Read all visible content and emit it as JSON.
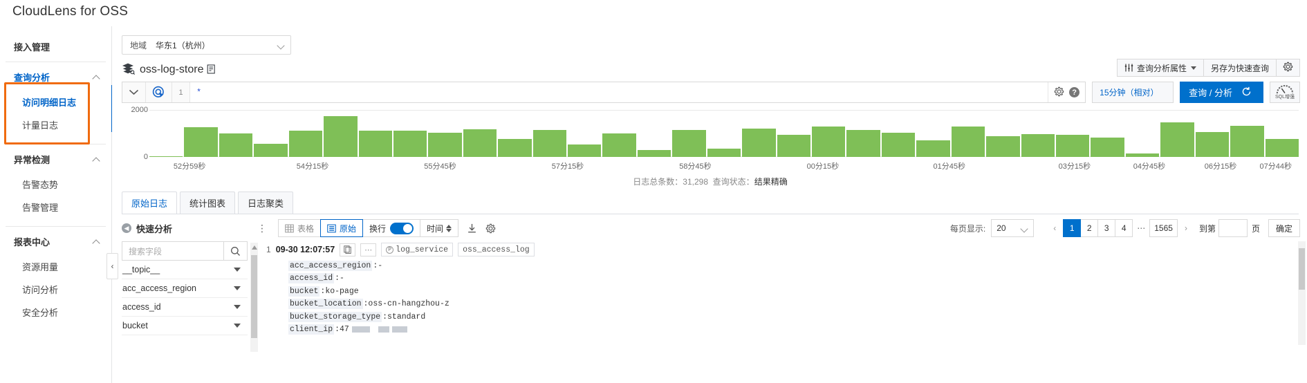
{
  "header": {
    "title": "CloudLens for OSS"
  },
  "sidebar": {
    "top_item": "接入管理",
    "groups": [
      {
        "title": "查询分析",
        "items": [
          "访问明细日志",
          "计量日志"
        ]
      },
      {
        "title": "异常检测",
        "items": [
          "告警态势",
          "告警管理"
        ]
      },
      {
        "title": "报表中心",
        "items": [
          "资源用量",
          "访问分析",
          "安全分析"
        ]
      }
    ],
    "collapse_glyph": "‹",
    "highlight_color": "#f06b0f",
    "active_color": "#0064c8"
  },
  "region": {
    "label": "地域",
    "value": "华东1（杭州）"
  },
  "logstore": {
    "name": "oss-log-store",
    "actions": [
      {
        "label": "查询分析属性",
        "has_caret": true,
        "icon": "sliders-icon"
      },
      {
        "label": "另存为快速查询",
        "has_caret": false,
        "icon": ""
      },
      {
        "label": "",
        "has_caret": false,
        "icon": "gear-icon"
      }
    ]
  },
  "query": {
    "line_number": "1",
    "value": "*",
    "time_range": "15分钟（相对）",
    "search_button": "查询 / 分析",
    "sql_label": "SQL增强"
  },
  "chart_data": {
    "type": "bar",
    "title": "",
    "xlabel": "",
    "ylabel": "",
    "ylim": [
      0,
      2000
    ],
    "ytick_labels": [
      "2000",
      "0"
    ],
    "grid": true,
    "legend": "none",
    "tick_labels": [
      "52分59秒",
      "54分15秒",
      "55分45秒",
      "57分15秒",
      "58分45秒",
      "00分15秒",
      "01分45秒",
      "03分15秒",
      "04分45秒",
      "06分15秒",
      "07分44秒"
    ],
    "tick_positions_pct": [
      3.5,
      14.2,
      25.3,
      36.4,
      47.5,
      58.6,
      69.6,
      80.5,
      87.0,
      93.2,
      98.0
    ],
    "categories": [
      "b1",
      "b2",
      "b3",
      "b4",
      "b5",
      "b6",
      "b7",
      "b8",
      "b9",
      "b10",
      "b11",
      "b12",
      "b13",
      "b14",
      "b15",
      "b16",
      "b17",
      "b18",
      "b19",
      "b20",
      "b21",
      "b22",
      "b23",
      "b24",
      "b25",
      "b26",
      "b27",
      "b28",
      "b29",
      "b30"
    ],
    "values": [
      40,
      1270,
      1000,
      560,
      1110,
      1740,
      1110,
      1110,
      1030,
      1180,
      760,
      1160,
      520,
      1000,
      300,
      1160,
      340,
      1200,
      950,
      1280,
      1150,
      1020,
      700,
      1290,
      870,
      980,
      940,
      810,
      160,
      1480
    ],
    "extra_values": [
      1060,
      1320,
      760
    ],
    "status_prefix": "日志总条数：",
    "status_count": "31,298",
    "status_label": "查询状态：",
    "status_value": "结果精确",
    "bar_color": "#7fbf57"
  },
  "tabs": [
    {
      "label": "原始日志",
      "active": true
    },
    {
      "label": "统计图表",
      "active": false
    },
    {
      "label": "日志聚类",
      "active": false
    }
  ],
  "content_toolbar": {
    "quick_analysis": "快速分析",
    "kebab": "⋮",
    "view_table": "表格",
    "view_raw": "原始",
    "wrap_label": "换行",
    "time_label": "时间",
    "download_icon": "download-icon",
    "settings_icon": "gear-icon"
  },
  "pagination": {
    "per_page_label": "每页显示:",
    "per_page_value": "20",
    "prev": "‹",
    "next": "›",
    "pages": [
      "1",
      "2",
      "3",
      "4"
    ],
    "dots": "⋯",
    "last_page": "1565",
    "current": "1",
    "goto_label": "到第",
    "goto_value": "",
    "page_unit": "页",
    "confirm": "确定"
  },
  "field_panel": {
    "search_placeholder": "搜索字段",
    "fields": [
      "__topic__",
      "acc_access_region",
      "access_id",
      "bucket"
    ]
  },
  "log_entry": {
    "index": "1",
    "timestamp": "09-30 12:07:57",
    "copy_icon": "copy-icon",
    "more": "⋯",
    "tag_project": "log_service",
    "tag_logstore": "oss_access_log",
    "fields": [
      {
        "key": "acc_access_region",
        "value": ":-"
      },
      {
        "key": "access_id",
        "value": ":-"
      },
      {
        "key": "bucket",
        "value": ":ko-page"
      },
      {
        "key": "bucket_location",
        "value": ":oss-cn-hangzhou-z"
      },
      {
        "key": "bucket_storage_type",
        "value": ":standard"
      },
      {
        "key": "client_ip",
        "value": ":47"
      }
    ]
  }
}
